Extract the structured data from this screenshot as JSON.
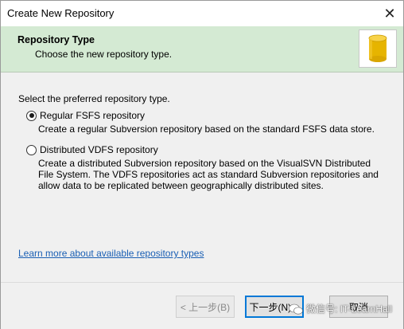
{
  "window": {
    "title": "Create New Repository",
    "close_glyph": "✕"
  },
  "banner": {
    "title": "Repository Type",
    "subtitle": "Choose the new repository type.",
    "icon": "database-icon",
    "icon_color": "#e6b400"
  },
  "content": {
    "prompt": "Select the preferred repository type.",
    "options": [
      {
        "label": "Regular FSFS repository",
        "checked": true,
        "description": "Create a regular Subversion repository based on the standard FSFS data store."
      },
      {
        "label": "Distributed VDFS repository",
        "checked": false,
        "description": "Create a distributed Subversion repository based on the VisualSVN Distributed File System. The VDFS repositories act as standard Subversion repositories and allow data to be replicated between geographically distributed sites."
      }
    ],
    "learn_more": "Learn more about available repository types"
  },
  "footer": {
    "back_label": "< 上一步(B)",
    "next_label": "下一步(N) >",
    "cancel_label": "取消"
  },
  "watermark": {
    "text": "微信号: IT-LearnHall"
  },
  "colors": {
    "banner_bg": "#d4ead3",
    "link": "#1a5fb4",
    "accent": "#0078d7"
  }
}
